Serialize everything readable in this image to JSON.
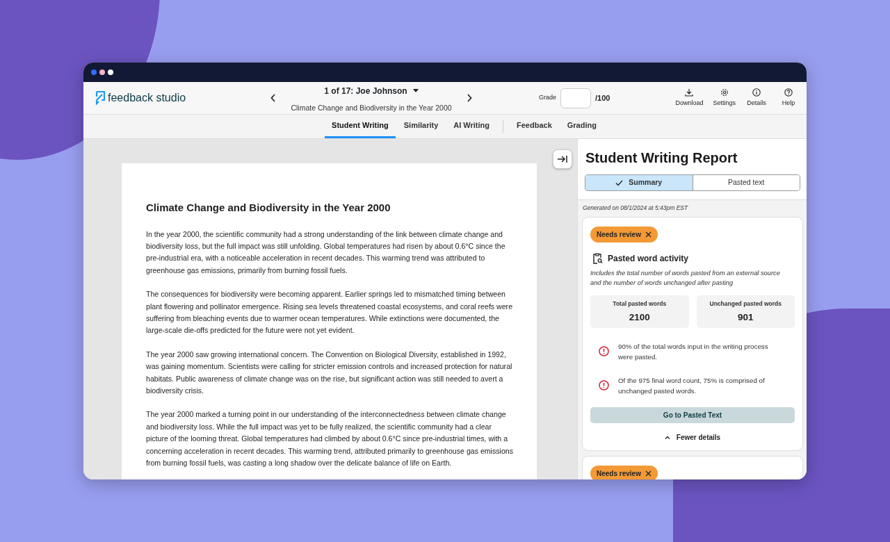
{
  "window": {
    "controls": [
      {
        "color": "#2f6df6"
      },
      {
        "color": "#f4b3c6"
      },
      {
        "color": "#ffffff"
      }
    ]
  },
  "header": {
    "logo": "feedback studio",
    "student": "1 of 17: Joe Johnson",
    "assignment": "Climate Change and Biodiversity in the Year 2000",
    "grade_label": "Grade",
    "grade_max": "/100",
    "actions": [
      {
        "kind": "download",
        "label": "Download"
      },
      {
        "kind": "settings",
        "label": "Settings"
      },
      {
        "kind": "info",
        "label": "Details"
      },
      {
        "kind": "help",
        "label": "Help"
      }
    ]
  },
  "tab_groups": [
    [
      {
        "label": "Student Writing",
        "selected": true
      },
      {
        "label": "Similarity",
        "selected": false
      },
      {
        "label": "AI Writing",
        "selected": false
      }
    ],
    [
      {
        "label": "Feedback",
        "selected": false
      },
      {
        "label": "Grading",
        "selected": false
      }
    ]
  ],
  "document": {
    "title": "Climate Change and Biodiversity in the Year 2000",
    "paragraphs": [
      "In the year 2000, the scientific community had a strong understanding of the link between climate change and biodiversity loss, but the full impact was still unfolding. Global temperatures had risen by about 0.6°C since the pre-industrial era, with a noticeable acceleration in recent decades. This warming trend was attributed to greenhouse gas emissions, primarily from burning fossil fuels.",
      "The consequences for biodiversity were becoming apparent. Earlier springs led to mismatched timing between plant flowering and pollinator emergence. Rising sea levels threatened coastal ecosystems, and coral reefs were suffering from bleaching events due to warmer ocean temperatures. While extinctions were documented, the large-scale die-offs predicted for the future were not yet evident.",
      "The year 2000 saw growing international concern. The Convention on Biological Diversity, established in 1992, was gaining momentum. Scientists were calling for stricter emission controls and increased protection for natural habitats. Public awareness of climate change was on the rise, but significant action was still needed to avert a biodiversity crisis.",
      "The year 2000 marked a turning point in our understanding of the interconnectedness between climate change and biodiversity loss. While the full impact was yet to be fully realized, the scientific community had a clear picture of the looming threat. Global temperatures had climbed by about 0.6°C since pre-industrial times, with a concerning acceleration in recent decades. This warming trend, attributed primarily to greenhouse gas emissions from burning fossil fuels, was casting a long shadow over the delicate balance of life on Earth."
    ]
  },
  "report": {
    "title": "Student Writing Report",
    "views": [
      {
        "label": "Summary",
        "selected": true
      },
      {
        "label": "Pasted text",
        "selected": false
      }
    ],
    "generated": "Generated on 08/1/2024 at 5:43pm EST",
    "cards": [
      {
        "badge": "Needs review",
        "heading": "Pasted word activity",
        "description": "Includes the total number of words pasted from an external source and the number of words unchanged after pasting",
        "stats": [
          {
            "label": "Total pasted words",
            "value": "2100"
          },
          {
            "label": "Unchanged pasted words",
            "value": "901"
          }
        ],
        "alerts": [
          "90% of the total words input in the writing process were pasted.",
          "Of the 975 final word count, 75% is comprised of unchanged pasted words."
        ],
        "action": "Go to Pasted Text",
        "toggle": "Fewer details"
      },
      {
        "badge": "Needs review"
      }
    ]
  }
}
